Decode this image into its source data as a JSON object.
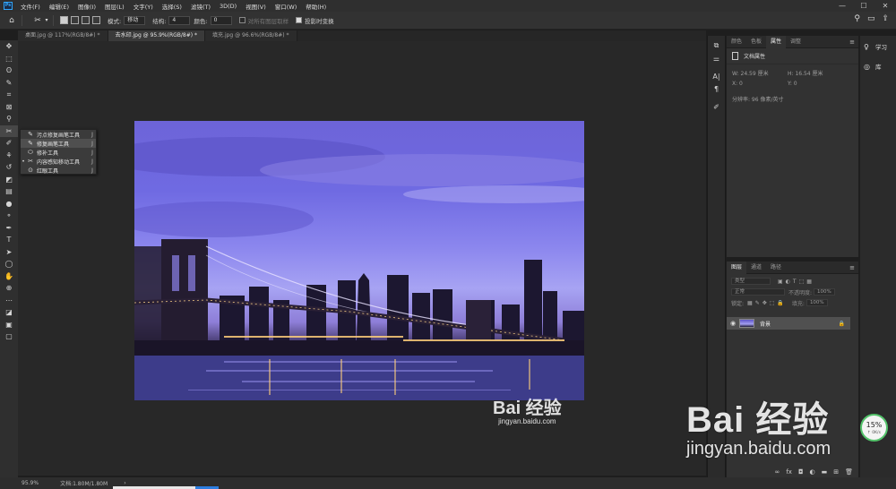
{
  "menubar": {
    "logo": "Ps",
    "items": [
      "文件(F)",
      "编辑(E)",
      "图像(I)",
      "图层(L)",
      "文字(Y)",
      "选择(S)",
      "滤镜(T)",
      "3D(D)",
      "视图(V)",
      "窗口(W)",
      "帮助(H)"
    ],
    "minimize": "—",
    "maximize": "☐",
    "close": "✕"
  },
  "options": {
    "mode_label": "模式:",
    "mode_value": "移动",
    "structure_label": "结构:",
    "structure_value": "4",
    "color_label": "颜色:",
    "color_value": "0",
    "sample_all_layers": "对所有图层取样",
    "transform_on_drop": "投影时变换"
  },
  "tabs": [
    {
      "label": "桌面.jpg @ 117%(RGB/8#) *"
    },
    {
      "label": "去水印.jpg @ 95.9%(RGB/8#) *"
    },
    {
      "label": "填充.jpg @ 96.6%(RGB/8#) *"
    }
  ],
  "flyout": {
    "items": [
      {
        "label": "污点修复画笔工具",
        "key": "J"
      },
      {
        "label": "修复画笔工具",
        "key": "J"
      },
      {
        "label": "修补工具",
        "key": "J"
      },
      {
        "label": "内容感知移动工具",
        "key": "J"
      },
      {
        "label": "红眼工具",
        "key": "J"
      }
    ]
  },
  "properties": {
    "tabs": [
      "颜色",
      "色板",
      "属性",
      "调整"
    ],
    "active_tab": "属性",
    "section": "文档属性",
    "width": "W: 24.59 厘米",
    "height": "H: 16.54 厘米",
    "x": "X: 0",
    "y": "Y: 0",
    "resolution": "分辨率: 96 像素/英寸"
  },
  "layers": {
    "tabs": [
      "图层",
      "通道",
      "路径"
    ],
    "active_tab": "图层",
    "filter": "类型",
    "blend_mode": "正常",
    "opacity_label": "不透明度:",
    "opacity_value": "100%",
    "lock_label": "锁定:",
    "fill_label": "填充:",
    "fill_value": "100%",
    "layer_name": "背景"
  },
  "learn": {
    "items": [
      "学习",
      "库"
    ]
  },
  "status": {
    "zoom": "95.9%",
    "doc_size": "文档:1.80M/1.80M",
    "arrow": "›"
  },
  "net_badge": {
    "percent": "15%",
    "rate": "↑ 0K/s"
  },
  "watermark_small": {
    "line1": "Bai 经验",
    "line2": "jingyan.baidu.com"
  },
  "watermark_big": {
    "line1": "Bai 经验",
    "line2": "jingyan.baidu.com"
  },
  "colors": {
    "accent": "#31a8ff",
    "selection_blue": "#2c7de0",
    "badge_green": "#53c26a"
  }
}
